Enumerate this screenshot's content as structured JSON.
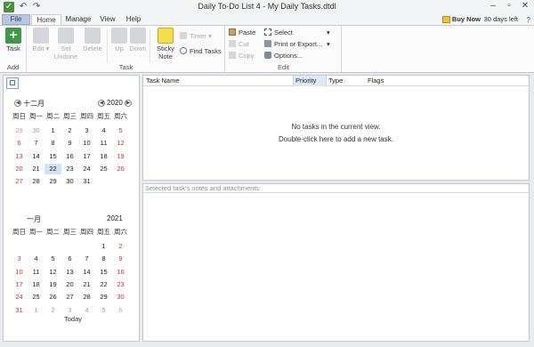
{
  "app": {
    "title": "Daily To-Do List 4 - My Daily Tasks.dtdl",
    "buy_now": "Buy Now",
    "days_left": "30 days left"
  },
  "quick_access": [
    "undo-icon",
    "redo-icon"
  ],
  "tabs": [
    "File",
    "Home",
    "Manage",
    "View",
    "Help"
  ],
  "ribbon": {
    "groups": {
      "add": "Add",
      "task": "Task",
      "edit": "Edit"
    },
    "add_task": "Task",
    "edit_btn": "Edit",
    "set_undone": "Set Undone",
    "delete_btn": "Delete",
    "up_btn": "Up",
    "down_btn": "Down",
    "sticky_note": "Sticky Note",
    "timer": "Timer",
    "find_tasks": "Find Tasks",
    "paste": "Paste",
    "cut": "Cut",
    "copy": "Copy",
    "select": "Select",
    "print_export": "Print or Export...",
    "options": "Options..."
  },
  "columns": {
    "task_name": "Task Name",
    "priority": "Priority",
    "type": "Type",
    "flags": "Flags"
  },
  "list": {
    "empty_line1": "No tasks in the current view.",
    "empty_line2": "Double-click here to add a new task."
  },
  "notes": {
    "label": "Selected task's notes and attachments:"
  },
  "calendar": {
    "weekdays": [
      "周日",
      "周一",
      "周二",
      "周三",
      "周四",
      "周五",
      "周六"
    ],
    "today_label": "Today",
    "months": [
      {
        "month": "十二月",
        "year": "2020",
        "selected": "22",
        "weeks": [
          [
            [
              "29",
              "o"
            ],
            [
              "30",
              "o"
            ],
            [
              "1",
              ""
            ],
            [
              "2",
              ""
            ],
            [
              "3",
              ""
            ],
            [
              "4",
              ""
            ],
            [
              "5",
              ""
            ]
          ],
          [
            [
              "6",
              ""
            ],
            [
              "7",
              ""
            ],
            [
              "8",
              ""
            ],
            [
              "9",
              ""
            ],
            [
              "10",
              ""
            ],
            [
              "11",
              ""
            ],
            [
              "12",
              ""
            ]
          ],
          [
            [
              "13",
              ""
            ],
            [
              "14",
              ""
            ],
            [
              "15",
              ""
            ],
            [
              "16",
              ""
            ],
            [
              "17",
              ""
            ],
            [
              "18",
              ""
            ],
            [
              "19",
              ""
            ]
          ],
          [
            [
              "20",
              ""
            ],
            [
              "21",
              ""
            ],
            [
              "22",
              "s"
            ],
            [
              "23",
              ""
            ],
            [
              "24",
              ""
            ],
            [
              "25",
              ""
            ],
            [
              "26",
              ""
            ]
          ],
          [
            [
              "27",
              ""
            ],
            [
              "28",
              ""
            ],
            [
              "29",
              ""
            ],
            [
              "30",
              ""
            ],
            [
              "31",
              ""
            ]
          ]
        ]
      },
      {
        "month": "一月",
        "year": "2021",
        "weeks": [
          [
            [],
            [],
            [],
            [],
            [],
            [
              "1",
              ""
            ],
            [
              "2",
              ""
            ]
          ],
          [
            [
              "3",
              ""
            ],
            [
              "4",
              ""
            ],
            [
              "5",
              ""
            ],
            [
              "6",
              ""
            ],
            [
              "7",
              ""
            ],
            [
              "8",
              ""
            ],
            [
              "9",
              ""
            ]
          ],
          [
            [
              "10",
              ""
            ],
            [
              "11",
              ""
            ],
            [
              "12",
              ""
            ],
            [
              "13",
              ""
            ],
            [
              "14",
              ""
            ],
            [
              "15",
              ""
            ],
            [
              "16",
              ""
            ]
          ],
          [
            [
              "17",
              ""
            ],
            [
              "18",
              ""
            ],
            [
              "19",
              ""
            ],
            [
              "20",
              ""
            ],
            [
              "21",
              ""
            ],
            [
              "22",
              ""
            ],
            [
              "23",
              ""
            ]
          ],
          [
            [
              "24",
              ""
            ],
            [
              "25",
              ""
            ],
            [
              "26",
              ""
            ],
            [
              "27",
              ""
            ],
            [
              "28",
              ""
            ],
            [
              "29",
              ""
            ],
            [
              "30",
              ""
            ]
          ],
          [
            [
              "31",
              ""
            ],
            [
              "1",
              "o"
            ],
            [
              "2",
              "o"
            ],
            [
              "3",
              "o"
            ],
            [
              "4",
              "o"
            ],
            [
              "5",
              "o"
            ],
            [
              "6",
              "o"
            ]
          ]
        ]
      }
    ]
  },
  "colors": {
    "accent": "#2f66b3",
    "weekend": "#c0392b",
    "selected_day": "#d2e2f7"
  }
}
